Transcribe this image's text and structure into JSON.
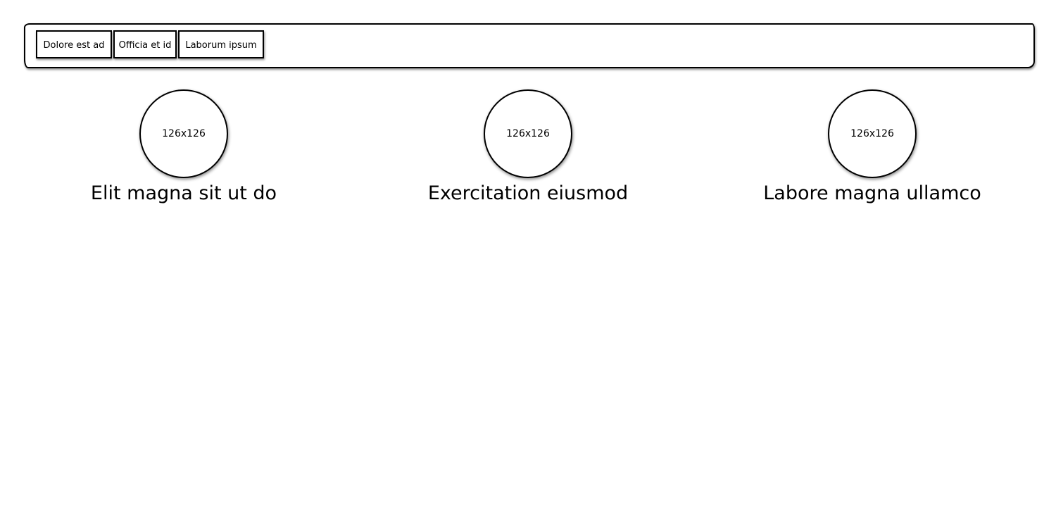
{
  "nav": {
    "items": [
      {
        "label": "Dolore est ad"
      },
      {
        "label": "Officia et id"
      },
      {
        "label": "Laborum ipsum"
      }
    ]
  },
  "cards": [
    {
      "image_label": "126x126",
      "title": "Elit magna sit ut do"
    },
    {
      "image_label": "126x126",
      "title": "Exercitation eiusmod"
    },
    {
      "image_label": "126x126",
      "title": "Labore magna ullamco"
    }
  ]
}
